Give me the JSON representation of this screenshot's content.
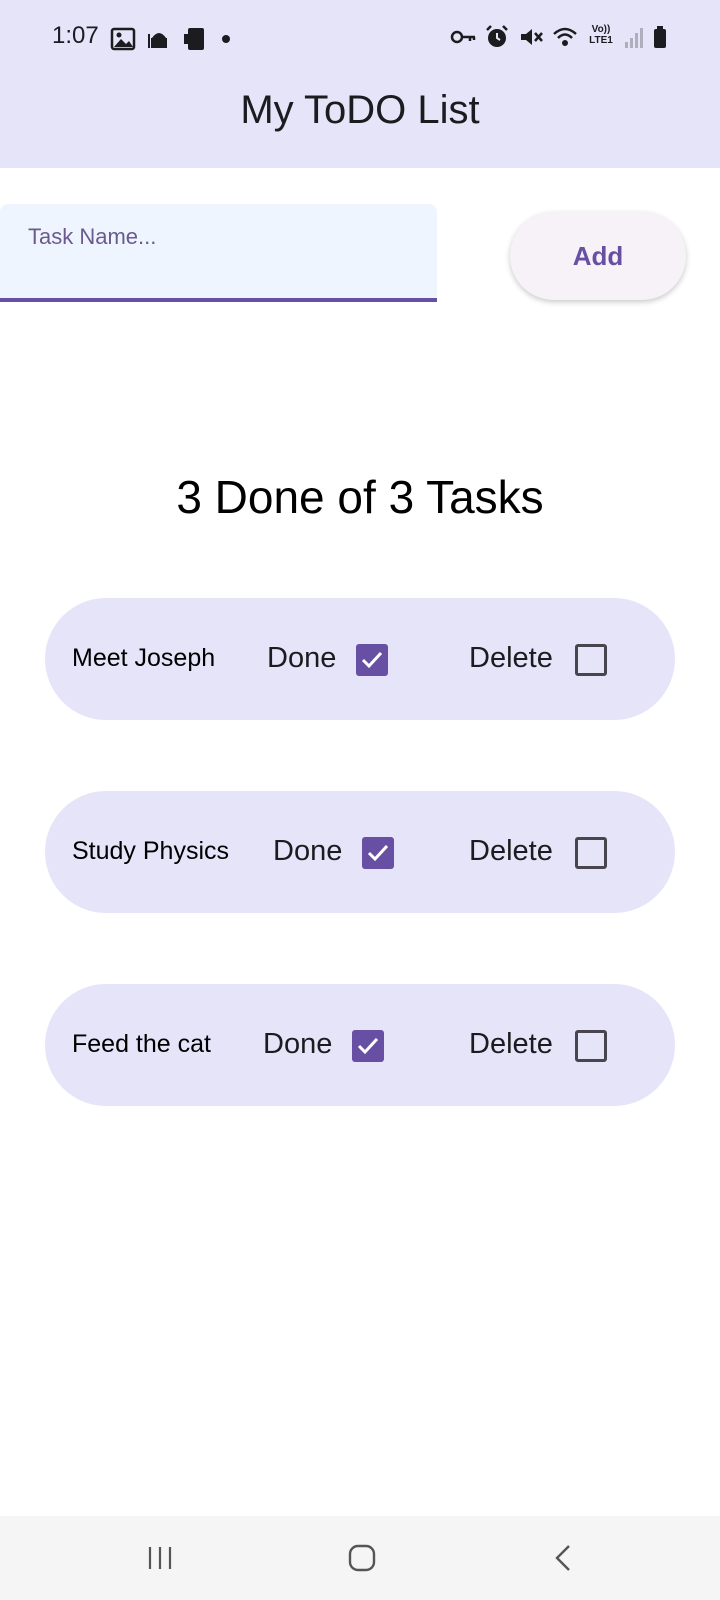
{
  "status_bar": {
    "time": "1:07",
    "network_label_top": "Vo))",
    "network_label_bottom": "LTE1",
    "icons_left": [
      "image-icon",
      "mosque-icon",
      "tablet-icon",
      "notification-dot"
    ],
    "icons_right": [
      "key-icon",
      "alarm-icon",
      "mute-icon",
      "wifi-icon",
      "volte-icon",
      "signal-icon",
      "battery-icon"
    ]
  },
  "app": {
    "title": "My ToDO List"
  },
  "input": {
    "placeholder": "Task Name...",
    "value": ""
  },
  "buttons": {
    "add_label": "Add"
  },
  "summary": {
    "text": "3 Done of 3 Tasks"
  },
  "tasks": [
    {
      "name": "Meet Joseph",
      "done_label": "Done",
      "done": true,
      "delete_label": "Delete",
      "delete": false
    },
    {
      "name": "Study Physics",
      "done_label": "Done",
      "done": true,
      "delete_label": "Delete",
      "delete": false
    },
    {
      "name": "Feed the cat",
      "done_label": "Done",
      "done": true,
      "delete_label": "Delete",
      "delete": false
    }
  ],
  "nav_bar": {
    "icons": [
      "recent-apps-icon",
      "home-icon",
      "back-icon"
    ]
  },
  "colors": {
    "header_bg": "#e6e4f8",
    "accent": "#6750a4",
    "row_bg": "#e6e4f8",
    "input_bg": "#eef5ff"
  }
}
